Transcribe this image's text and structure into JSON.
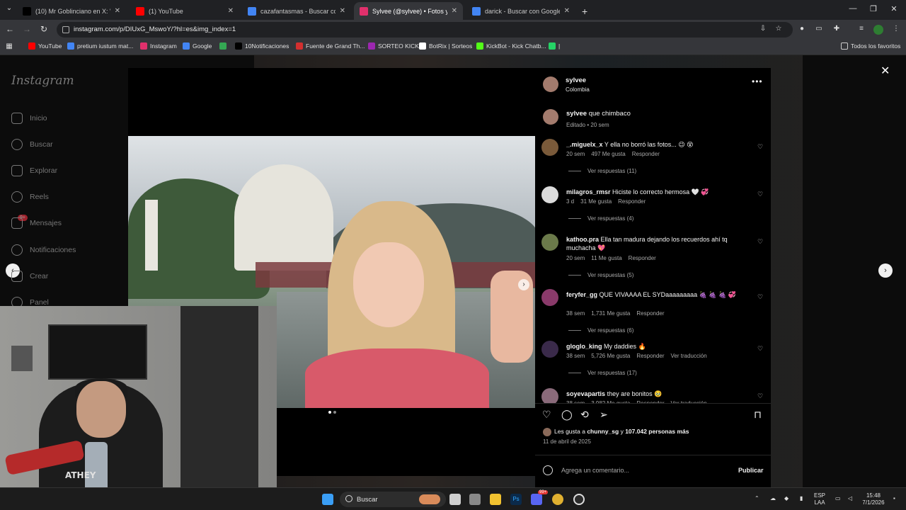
{
  "browser": {
    "tabs": [
      {
        "title": "(10) Mr Goblinciano en X: \"Dar",
        "icon": "x-icon",
        "color": "#000000",
        "active": false
      },
      {
        "title": "(1) YouTube",
        "icon": "youtube-icon",
        "color": "#ff0000",
        "active": false
      },
      {
        "title": "cazafantasmas - Buscar con Go",
        "icon": "google-icon",
        "color": "#4285f4",
        "active": false
      },
      {
        "title": "Sylvee (@sylvee) • Fotos y vide",
        "icon": "instagram-icon",
        "color": "#e1306c",
        "active": true
      },
      {
        "title": "darick - Buscar con Google",
        "icon": "google-icon",
        "color": "#4285f4",
        "active": false
      }
    ],
    "new_tab": "+",
    "url": "instagram.com/p/DIUxG_MswoY/?hl=es&img_index=1",
    "bookmarks": [
      {
        "label": "YouTube",
        "color": "#ff0000"
      },
      {
        "label": "pretium iustum mat...",
        "color": "#4285f4"
      },
      {
        "label": "Instagram",
        "color": "#e1306c"
      },
      {
        "label": "Google",
        "color": "#4285f4"
      },
      {
        "label": "",
        "color": "#34a853"
      },
      {
        "label": "10Notificaciones",
        "color": "#000000"
      },
      {
        "label": "Fuente de Grand Th...",
        "color": "#d32f2f"
      },
      {
        "label": "SORTEO KICK",
        "color": "#9c27b0"
      },
      {
        "label": "BotRix | Sorteos",
        "color": "#ffffff"
      },
      {
        "label": "KickBot - Kick Chatb...",
        "color": "#53fc18"
      },
      {
        "label": "|",
        "color": "#25d366"
      }
    ],
    "all_favorites": "Todos los favoritos"
  },
  "instagram": {
    "logo": "Instagram",
    "nav": [
      {
        "label": "Inicio",
        "icon": "home-icon"
      },
      {
        "label": "Buscar",
        "icon": "search-icon"
      },
      {
        "label": "Explorar",
        "icon": "compass-icon"
      },
      {
        "label": "Reels",
        "icon": "reels-icon"
      },
      {
        "label": "Mensajes",
        "icon": "messages-icon"
      },
      {
        "label": "Notificaciones",
        "icon": "heart-icon"
      },
      {
        "label": "Crear",
        "icon": "plus-icon"
      },
      {
        "label": "Panel",
        "icon": "panel-icon"
      }
    ],
    "messages_badge": "9+",
    "post": {
      "user": "sylvee",
      "location": "Colombia",
      "caption_user": "sylvee",
      "caption": "que chimbaco",
      "caption_meta": "Editado • 20 sem",
      "comments": [
        {
          "user": "_.miguelx_x",
          "text": "Y ella no borró las fotos... 😉 😵",
          "time": "20 sem",
          "likes": "497 Me gusta",
          "reply": "Responder",
          "translate": "",
          "replies": "Ver respuestas (11)",
          "avatar_color": "#7a5a3a"
        },
        {
          "user": "milagros_rmsr",
          "text": "Hiciste lo correcto hermosa 🤍 💞",
          "time": "3 d",
          "likes": "31 Me gusta",
          "reply": "Responder",
          "translate": "",
          "replies": "Ver respuestas (4)",
          "avatar_color": "#dbdbdb"
        },
        {
          "user": "kathoo.pra",
          "text": "Ella tan madura dejando los recuerdos ahí tq muchacha 💖",
          "time": "20 sem",
          "likes": "11 Me gusta",
          "reply": "Responder",
          "translate": "",
          "replies": "Ver respuestas (5)",
          "avatar_color": "#6b7a4a"
        },
        {
          "user": "feryfer_gg",
          "text": "QUE VIVAAAA EL SYDaaaaaaaaa 🍇 🍇 🍇 💞",
          "time": "38 sem",
          "likes": "1,731 Me gusta",
          "reply": "Responder",
          "translate": "",
          "replies": "Ver respuestas (6)",
          "avatar_color": "#8a3a6a"
        },
        {
          "user": "gloglo_king",
          "text": "My daddies 🔥",
          "time": "38 sem",
          "likes": "5,726 Me gusta",
          "reply": "Responder",
          "translate": "Ver traducción",
          "replies": "Ver respuestas (17)",
          "avatar_color": "#3a2a4a"
        },
        {
          "user": "soyevapartis",
          "text": "they are bonitos 🥹",
          "time": "38 sem",
          "likes": "3,982 Me gusta",
          "reply": "Responder",
          "translate": "Ver traducción",
          "replies": "",
          "avatar_color": "#8a6a7a"
        }
      ],
      "likes_prefix": "Les gusta a",
      "likes_user": "chunny_sg",
      "likes_mid": "y",
      "likes_count": "107.042 personas más",
      "date": "11 de abril de 2025",
      "comment_placeholder": "Agrega un comentario...",
      "publish": "Publicar"
    }
  },
  "webcam": {
    "shirt_text": "ATHEY"
  },
  "taskbar": {
    "search_label": "Buscar",
    "lang_top": "ESP",
    "lang_bottom": "LAA",
    "time": "15:48",
    "date": "7/1/2026",
    "discord_badge": "99+"
  }
}
